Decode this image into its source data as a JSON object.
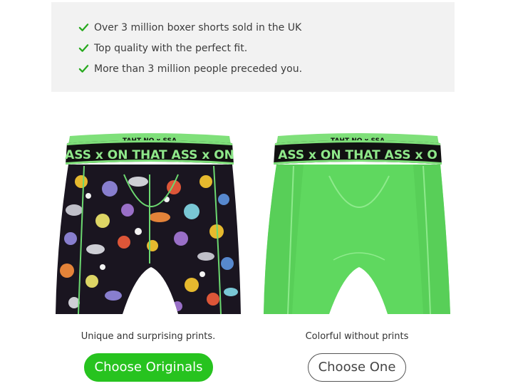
{
  "benefits": {
    "items": [
      "Over 3 million boxer shorts sold in the UK",
      "Top quality with the perfect fit.",
      "More than 3 million people preceded you."
    ],
    "check_color": "#27a91e",
    "icon": "check-icon"
  },
  "products": {
    "originals": {
      "waistband_text": "ASS ⅹ ON THAT ASS ⅹ ON",
      "waistband_top_text": "TAHT NO ⅹ SSA",
      "caption": "Unique and surprising prints.",
      "button_label": "Choose Originals"
    },
    "one": {
      "waistband_text": "ASS ⅹ ON THAT ASS ⅹ O",
      "waistband_top_text": "TAHT NO ⅹ SSA",
      "caption": "Colorful without prints",
      "button_label": "Choose One"
    }
  },
  "colors": {
    "accent_green": "#27c31f",
    "boxer_green": "#5fd85f",
    "waistband": "#111111",
    "panel_bg": "#f2f2f2"
  }
}
